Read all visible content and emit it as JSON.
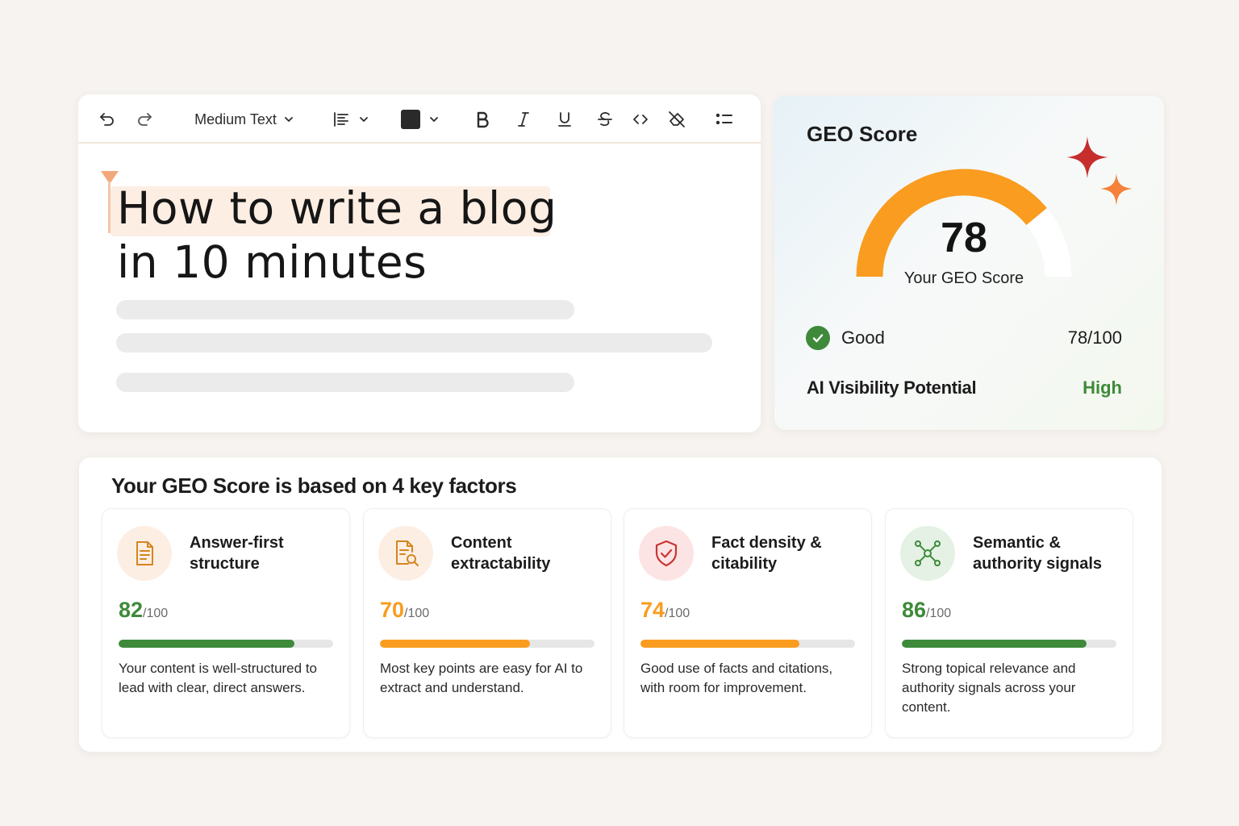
{
  "toolbar": {
    "text_style": "Medium Text",
    "text_color": "#2a2a2a"
  },
  "document": {
    "title_line1": "How to write a blog",
    "title_line2": "in 10 minutes"
  },
  "geo": {
    "title": "GEO Score",
    "score": "78",
    "score_value": 78,
    "score_max": 100,
    "caption": "Your GEO Score",
    "status_label": "Good",
    "status_score": "78/100",
    "visibility_label": "AI Visibility Potential",
    "visibility_value": "High",
    "colors": {
      "gauge": "#f99c1f",
      "good": "#3e8a3a",
      "sparkle_red": "#c62d2d",
      "sparkle_orange": "#f6813b"
    }
  },
  "factors": {
    "title": "Your GEO Score is based on 4 key factors",
    "items": [
      {
        "name": "Answer-first structure",
        "icon": "document-list-icon",
        "score": "82",
        "denominator": "/100",
        "value": 82,
        "color": "#3e8a3a",
        "icon_bg": "#fdeee3",
        "icon_color": "#d4861f",
        "description": "Your content is well-structured to lead with clear, direct answers."
      },
      {
        "name": "Content extractability",
        "icon": "document-search-icon",
        "score": "70",
        "denominator": "/100",
        "value": 70,
        "color": "#f99c1f",
        "icon_bg": "#fdeee3",
        "icon_color": "#d4861f",
        "description": "Most key points are easy for AI to extract and understand."
      },
      {
        "name": "Fact density & citability",
        "icon": "shield-check-icon",
        "score": "74",
        "denominator": "/100",
        "value": 74,
        "color": "#f99c1f",
        "icon_bg": "#fde4e4",
        "icon_color": "#c93636",
        "description": "Good use of facts and citations, with room for improvement."
      },
      {
        "name": "Semantic & authority signals",
        "icon": "network-nodes-icon",
        "score": "86",
        "denominator": "/100",
        "value": 86,
        "color": "#3e8a3a",
        "icon_bg": "#e4f1e4",
        "icon_color": "#3e8a3a",
        "description": "Strong topical relevance and authority signals across your content."
      }
    ]
  }
}
